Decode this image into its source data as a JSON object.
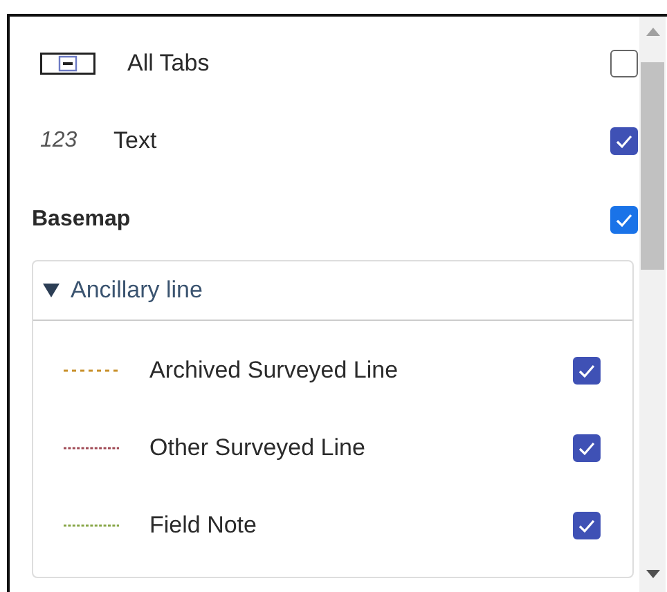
{
  "layers": [
    {
      "kind": "tabs",
      "label": "All Tabs",
      "checked": false
    },
    {
      "kind": "number",
      "symbol": "123",
      "label": "Text",
      "checked": true
    },
    {
      "kind": "heading",
      "label": "Basemap",
      "checked": true
    }
  ],
  "group": {
    "title": "Ancillary line",
    "expanded": true,
    "items": [
      {
        "label": "Archived Surveyed Line",
        "color": "#c8902a",
        "checked": true
      },
      {
        "label": "Other Surveyed Line",
        "color": "#a04a55",
        "checked": true
      },
      {
        "label": "Field Note",
        "color": "#8aa84a",
        "checked": true
      }
    ]
  }
}
